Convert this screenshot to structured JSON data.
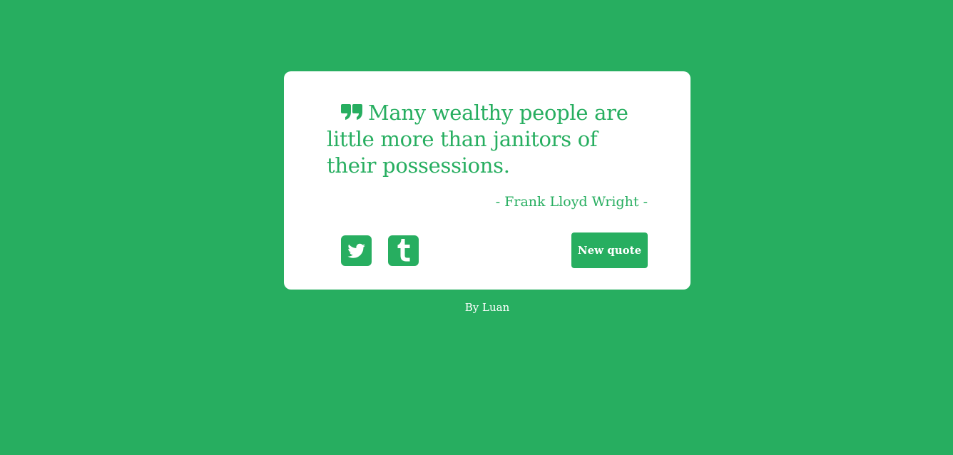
{
  "quote": {
    "icon": "quote-left-icon",
    "text": "Many wealthy people are little more than janitors of their possessions.",
    "author": "- Frank Lloyd Wright -"
  },
  "actions": {
    "twitter_icon": "twitter-icon",
    "tumblr_icon": "tumblr-icon",
    "new_quote_label": "New quote"
  },
  "footer": {
    "credit": "By Luan"
  },
  "colors": {
    "background": "#27ae60",
    "card": "#ffffff",
    "accent": "#27ae60"
  }
}
